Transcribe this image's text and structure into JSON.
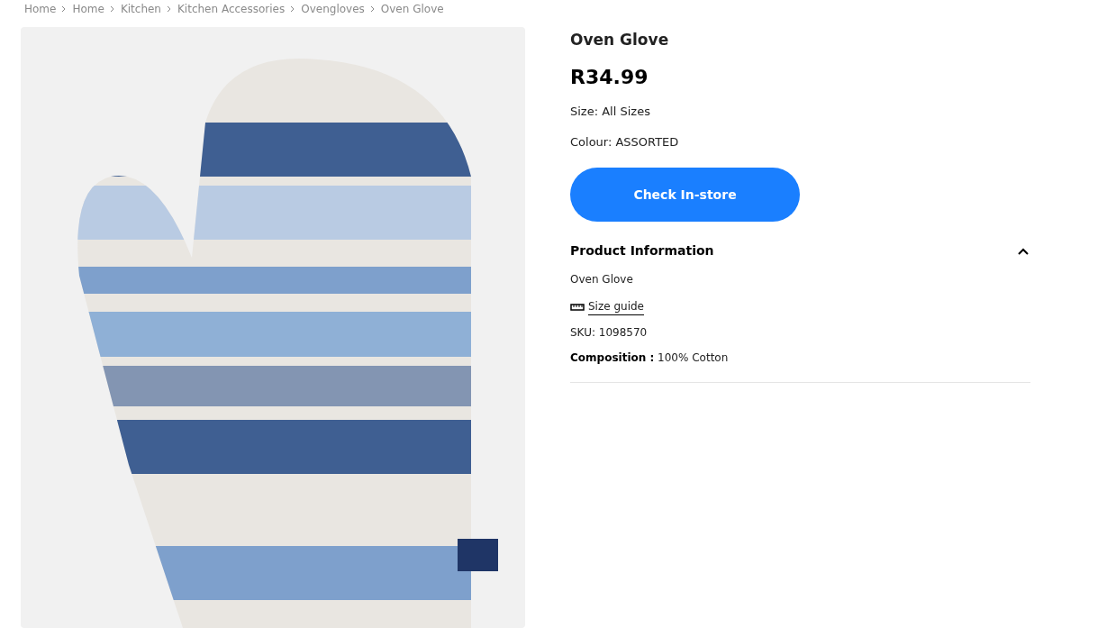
{
  "breadcrumb": [
    "Home",
    "Home",
    "Kitchen",
    "Kitchen Accessories",
    "Ovengloves",
    "Oven Glove"
  ],
  "product": {
    "title": "Oven Glove",
    "price": "R34.99",
    "size": "Size: All Sizes",
    "colour": "Colour: ASSORTED",
    "button": "Check In-store"
  },
  "product_information": {
    "heading": "Product Information",
    "expanded": true,
    "description": "Oven Glove",
    "size_guide": "Size guide",
    "sku": "SKU: 1098570",
    "composition_label": "Composition :",
    "composition_value": "100% Cotton"
  }
}
